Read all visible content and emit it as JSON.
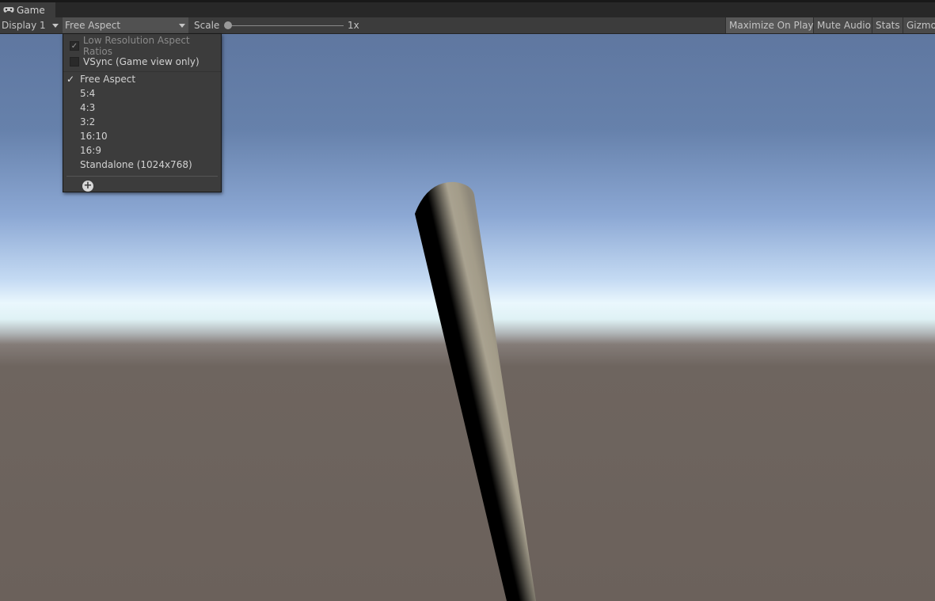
{
  "tab": {
    "label": "Game",
    "icon": "gamepad-icon"
  },
  "toolbar": {
    "display_label": "Display 1",
    "aspect_label": "Free Aspect",
    "scale_label": "Scale",
    "scale_value": "1x",
    "scale_slider_fraction": 0,
    "maximize_label": "Maximize On Play",
    "mute_label": "Mute Audio",
    "stats_label": "Stats",
    "gizmos_label": "Gizmos"
  },
  "aspect_menu": {
    "low_res_label": "Low Resolution Aspect Ratios",
    "low_res_checked": true,
    "low_res_disabled": true,
    "vsync_label": "VSync (Game view only)",
    "vsync_checked": false,
    "items": [
      {
        "label": "Free Aspect",
        "checked": true
      },
      {
        "label": "5:4",
        "checked": false
      },
      {
        "label": "4:3",
        "checked": false
      },
      {
        "label": "3:2",
        "checked": false
      },
      {
        "label": "16:10",
        "checked": false
      },
      {
        "label": "16:9",
        "checked": false
      },
      {
        "label": "Standalone (1024x768)",
        "checked": false
      }
    ],
    "check_glyph": "✓",
    "add_icon": "plus-circle-icon"
  },
  "colors": {
    "toolbar_bg": "#3c3c3c",
    "menu_bg": "#3c3c3c",
    "sky_top": "#5f77a0",
    "horizon": "#eaf7fd",
    "ground": "#6b615b",
    "cylinder_light": "#a7a08e"
  }
}
